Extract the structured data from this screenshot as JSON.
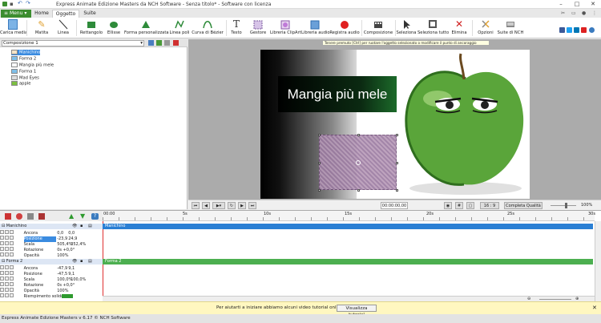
{
  "window": {
    "title": "Express Animate Edizione Masters da NCH Software - Senza titolo* - Software con licenza",
    "controls": [
      "–",
      "□",
      "✕"
    ]
  },
  "menubar": {
    "menu_label": "Menu",
    "tabs": [
      "Home",
      "Oggetto",
      "Suite"
    ],
    "active_tab": "Oggetto"
  },
  "toolbar": {
    "buttons": [
      {
        "label": "Carica media",
        "icon": "load-media-icon"
      },
      {
        "label": "Matita",
        "icon": "pencil-icon"
      },
      {
        "label": "Linea",
        "icon": "line-icon"
      },
      {
        "label": "Rettangolo",
        "icon": "rectangle-icon"
      },
      {
        "label": "Ellisse",
        "icon": "ellipse-icon"
      },
      {
        "label": "Forma personalizzata",
        "icon": "custom-shape-icon"
      },
      {
        "label": "Linea poli",
        "icon": "polyline-icon"
      },
      {
        "label": "Curva di Bézier",
        "icon": "bezier-icon"
      },
      {
        "label": "Testo",
        "icon": "text-icon"
      },
      {
        "label": "Gestore",
        "icon": "handler-icon"
      },
      {
        "label": "Libreria ClipArt",
        "icon": "clipart-icon"
      },
      {
        "label": "Libreria audio",
        "icon": "audio-library-icon"
      },
      {
        "label": "Registra audio",
        "icon": "record-icon"
      },
      {
        "label": "Composizione",
        "icon": "composition-icon"
      },
      {
        "label": "Seleziona",
        "icon": "select-icon"
      },
      {
        "label": "Seleziona tutto",
        "icon": "select-all-icon"
      },
      {
        "label": "Elimina",
        "icon": "delete-icon"
      },
      {
        "label": "Opzioni",
        "icon": "options-icon"
      },
      {
        "label": "Suite di NCH",
        "icon": "nch-suite-icon"
      }
    ]
  },
  "social": [
    "facebook-icon",
    "twitter-icon",
    "linkedin-icon",
    "youtube-icon",
    "help-icon"
  ],
  "left_panel": {
    "composition": "Composizione 1",
    "tree": [
      {
        "label": "Manichino",
        "icon": "mannequin-icon",
        "selected": true
      },
      {
        "label": "Forma 2",
        "icon": "shape-icon",
        "selected": false
      },
      {
        "label": "Mangia più mele",
        "icon": "text-layer-icon",
        "selected": false
      },
      {
        "label": "Forma 1",
        "icon": "shape-icon",
        "selected": false
      },
      {
        "label": "Mad Eyes",
        "icon": "clipart-layer-icon",
        "selected": false
      },
      {
        "label": "apple",
        "icon": "image-layer-icon",
        "selected": false
      }
    ]
  },
  "canvas": {
    "tooltip": "Tenere premuto [Ctrl] per ruotare l'oggetto selezionato o modificare il punto di ancoraggio",
    "text_box": "Mangia più mele"
  },
  "player": {
    "timecode": "00:00:00,00",
    "aspect": "16 : 9",
    "quality": "Completa Qualità",
    "zoom": "100%"
  },
  "timeline": {
    "ruler": [
      "00:00",
      "5s",
      "10s",
      "15s",
      "20s",
      "25s",
      "30s"
    ],
    "groups": [
      {
        "name": "Manichino",
        "bar_label": "Manichino",
        "bar_color": "#2a7fd4",
        "props": [
          {
            "name": "Ancora",
            "vals": [
              "0,0",
              "0,0"
            ]
          },
          {
            "name": "Posizione",
            "vals": [
              "-23,9",
              "24,9"
            ],
            "selected": true
          },
          {
            "name": "Scala",
            "vals": [
              "505,4%",
              "352,4%"
            ]
          },
          {
            "name": "Rotazione",
            "vals": [
              "0s +0,0°"
            ]
          },
          {
            "name": "Opacità",
            "vals": [
              "100%"
            ]
          }
        ]
      },
      {
        "name": "Forma 2",
        "bar_label": "Forma 2",
        "bar_color": "#4caf50",
        "props": [
          {
            "name": "Ancora",
            "vals": [
              "-47,9",
              "9,1"
            ]
          },
          {
            "name": "Posizione",
            "vals": [
              "-47,5",
              "9,1"
            ]
          },
          {
            "name": "Scala",
            "vals": [
              "100,0%",
              "100,0%"
            ]
          },
          {
            "name": "Rotazione",
            "vals": [
              "0s +0,0°"
            ]
          },
          {
            "name": "Opacità",
            "vals": [
              "100%"
            ]
          },
          {
            "name": "Riempimento solido",
            "vals": [
              ""
            ]
          }
        ]
      }
    ]
  },
  "notification": {
    "text": "Per aiutarti a iniziare abbiamo alcuni video tutorial online per te",
    "button": "Visualizza tutorial"
  },
  "status": "Express Animate Edizione Masters v 6.17 © NCH Software"
}
